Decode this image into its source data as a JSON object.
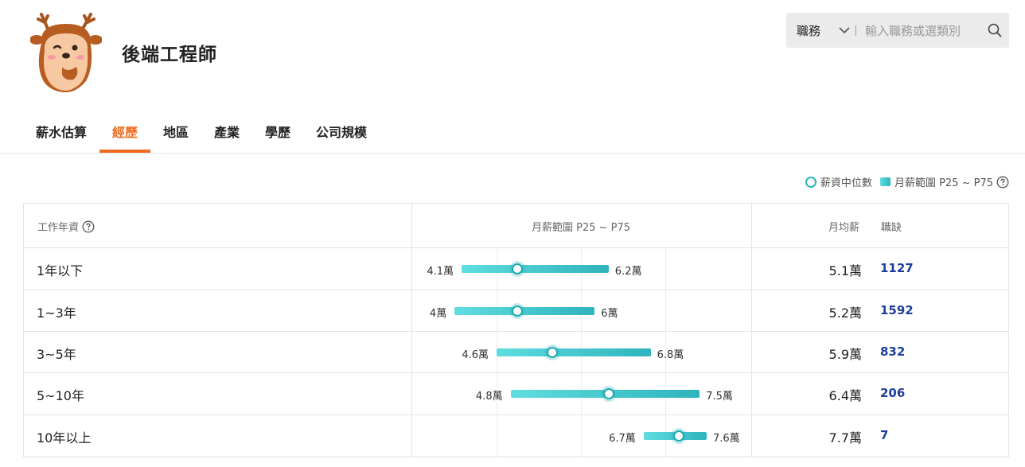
{
  "job": {
    "title": "後端工程師"
  },
  "search": {
    "category": "職務",
    "placeholder": "輸入職務或選類別"
  },
  "tabs": [
    {
      "label": "薪水估算",
      "active": false
    },
    {
      "label": "經歷",
      "active": true
    },
    {
      "label": "地區",
      "active": false
    },
    {
      "label": "產業",
      "active": false
    },
    {
      "label": "學歷",
      "active": false
    },
    {
      "label": "公司規模",
      "active": false
    }
  ],
  "legend": {
    "median_label": "薪資中位數",
    "range_label": "月薪範圍 P25 ~ P75"
  },
  "table": {
    "headers": {
      "experience": "工作年資",
      "range": "月薪範圍 P25 ~ P75",
      "avg": "月均薪",
      "openings": "職缺"
    },
    "rows": [
      {
        "experience": "1年以下",
        "p25_label": "4.1萬",
        "p75_label": "6.2萬",
        "avg": "5.1萬",
        "openings": "1127"
      },
      {
        "experience": "1~3年",
        "p25_label": "4萬",
        "p75_label": "6萬",
        "avg": "5.2萬",
        "openings": "1592"
      },
      {
        "experience": "3~5年",
        "p25_label": "4.6萬",
        "p75_label": "6.8萬",
        "avg": "5.9萬",
        "openings": "832"
      },
      {
        "experience": "5~10年",
        "p25_label": "4.8萬",
        "p75_label": "7.5萬",
        "avg": "6.4萬",
        "openings": "206"
      },
      {
        "experience": "10年以上",
        "p25_label": "6.7萬",
        "p75_label": "7.6萬",
        "avg": "7.7萬",
        "openings": "7"
      }
    ]
  },
  "chart_data": {
    "type": "bar",
    "categories": [
      "1年以下",
      "1~3年",
      "3~5年",
      "5~10年",
      "10年以上"
    ],
    "series": [
      {
        "name": "P25",
        "values": [
          4.1,
          4.0,
          4.6,
          4.8,
          6.7
        ]
      },
      {
        "name": "P75",
        "values": [
          6.2,
          6.0,
          6.8,
          7.5,
          7.6
        ]
      },
      {
        "name": "薪資中位數",
        "values": [
          4.9,
          4.9,
          5.4,
          6.2,
          7.2
        ]
      }
    ]
  },
  "colors": {
    "accent": "#ef6c1e",
    "bar_start": "#5fdde0",
    "bar_end": "#2fb4bc",
    "openings": "#1d3e9e"
  }
}
